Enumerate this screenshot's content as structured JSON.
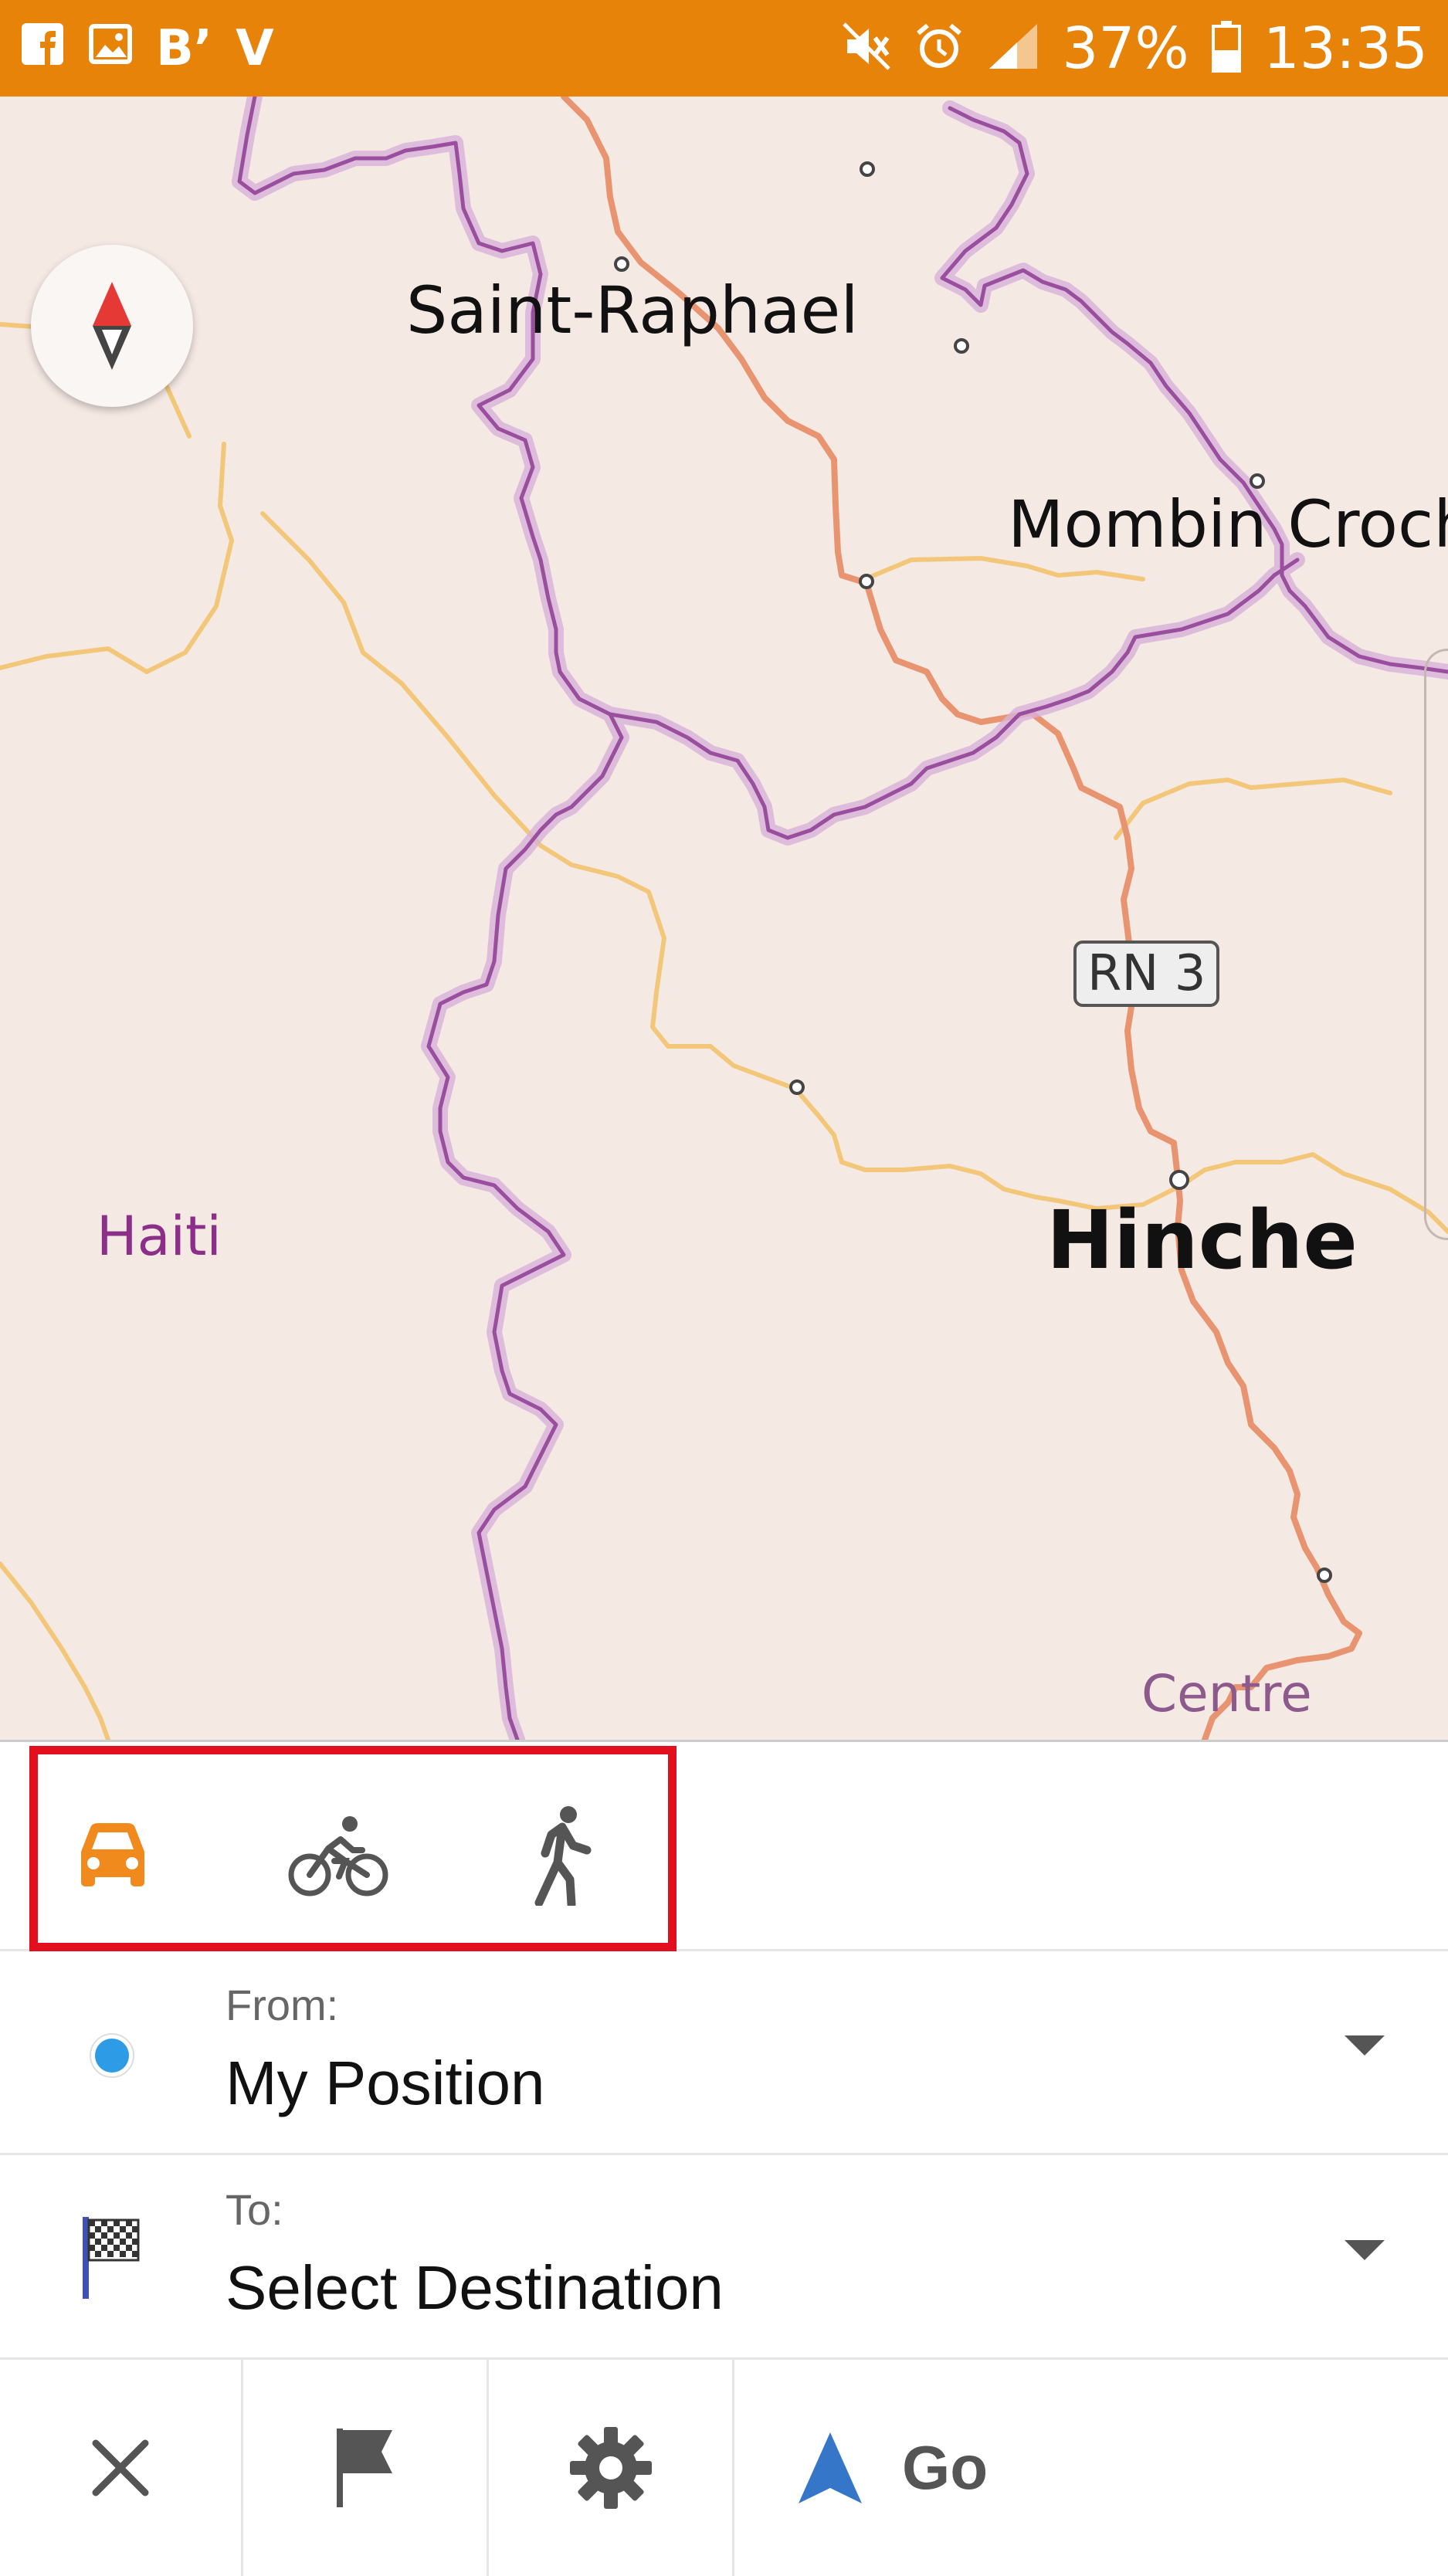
{
  "status_bar": {
    "battery_percent": "37%",
    "time": "13:35",
    "notification_icons": [
      "facebook-icon",
      "gallery-icon",
      "b-app-icon",
      "v-app-icon"
    ],
    "system_icons": [
      "mute-icon",
      "alarm-icon",
      "signal-icon",
      "battery-icon"
    ],
    "color": "#E8830A"
  },
  "map": {
    "labels": {
      "saint_raphael": "Saint-Raphael",
      "mombin": "Mombin Croch",
      "hinche": "Hinche",
      "haiti": "Haiti",
      "centre": "Centre",
      "road": "RN 3"
    },
    "compass_icon": "compass-icon"
  },
  "route_panel": {
    "modes": [
      {
        "name": "car",
        "icon": "car-icon",
        "selected": true
      },
      {
        "name": "bicycle",
        "icon": "bicycle-icon",
        "selected": false
      },
      {
        "name": "walk",
        "icon": "pedestrian-icon",
        "selected": false
      }
    ],
    "from": {
      "label": "From:",
      "value": "My Position"
    },
    "to": {
      "label": "To:",
      "value": "Select Destination"
    },
    "actions": {
      "close_icon": "close-icon",
      "flag_icon": "flag-icon",
      "settings_icon": "gear-icon",
      "go_label": "Go"
    },
    "accent_color": "#F08A1C",
    "highlight_color": "#E2101F"
  }
}
